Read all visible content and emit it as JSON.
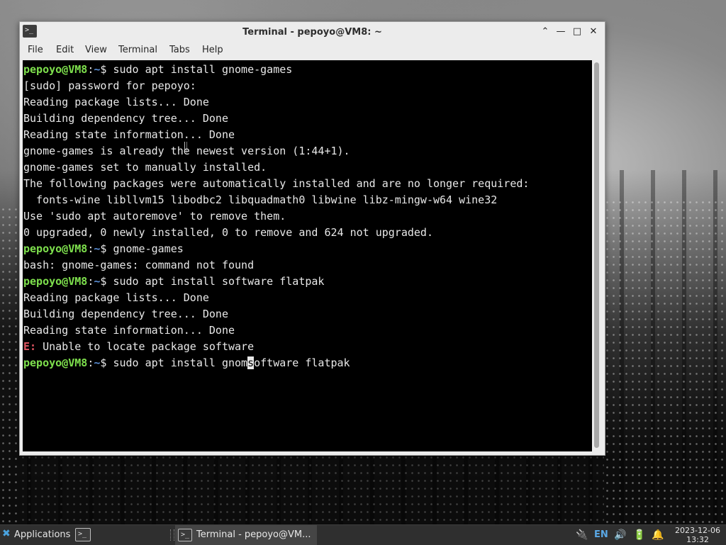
{
  "window": {
    "title": "Terminal - pepoyo@VM8: ~",
    "app_icon_glyph": ">_",
    "controls": {
      "shade": "⌃",
      "minimize": "—",
      "maximize": "□",
      "close": "✕"
    }
  },
  "menubar": {
    "items": [
      "File",
      "Edit",
      "View",
      "Terminal",
      "Tabs",
      "Help"
    ]
  },
  "terminal": {
    "prompt": {
      "user": "pepoyo@VM8",
      "sep": ":",
      "path": "~",
      "symbol": "$ "
    },
    "lines": [
      {
        "type": "prompt",
        "cmd": "sudo apt install gnome-games"
      },
      {
        "type": "out",
        "text": "[sudo] password for pepoyo:"
      },
      {
        "type": "out",
        "text": "Reading package lists... Done"
      },
      {
        "type": "out",
        "text": "Building dependency tree... Done"
      },
      {
        "type": "out",
        "text": "Reading state information... Done"
      },
      {
        "type": "out",
        "text": "gnome-games is already the newest version (1:44+1)."
      },
      {
        "type": "out",
        "text": "gnome-games set to manually installed."
      },
      {
        "type": "out",
        "text": "The following packages were automatically installed and are no longer required:"
      },
      {
        "type": "out",
        "text": "  fonts-wine libllvm15 libodbc2 libquadmath0 libwine libz-mingw-w64 wine32"
      },
      {
        "type": "out",
        "text": "Use 'sudo apt autoremove' to remove them."
      },
      {
        "type": "out",
        "text": "0 upgraded, 0 newly installed, 0 to remove and 624 not upgraded."
      },
      {
        "type": "prompt",
        "cmd": "gnome-games"
      },
      {
        "type": "out",
        "text": "bash: gnome-games: command not found"
      },
      {
        "type": "prompt",
        "cmd": "sudo apt install software flatpak"
      },
      {
        "type": "out",
        "text": "Reading package lists... Done"
      },
      {
        "type": "out",
        "text": "Building dependency tree... Done"
      },
      {
        "type": "out",
        "text": "Reading state information... Done"
      },
      {
        "type": "error",
        "label": "E:",
        "text": " Unable to locate package software"
      },
      {
        "type": "prompt_cursor",
        "before": "sudo apt install gnom",
        "cursor": "s",
        "after": "oftware flatpak"
      }
    ]
  },
  "taskbar": {
    "applications_label": "Applications",
    "launcher_glyph": ">_",
    "task_label": "Terminal - pepoyo@VM...",
    "task_glyph": ">_",
    "tray": {
      "language": "EN",
      "network_icon": "🔌",
      "volume_icon": "🔊",
      "battery_icon": "🔋",
      "notification_icon": "🔔"
    },
    "clock": {
      "date": "2023-12-06",
      "time": "13:32"
    }
  },
  "colors": {
    "prompt_user": "#7ee04d",
    "prompt_path": "#5b8fd6",
    "error": "#e05561",
    "terminal_bg": "#000000",
    "terminal_fg": "#e8e8e8"
  }
}
